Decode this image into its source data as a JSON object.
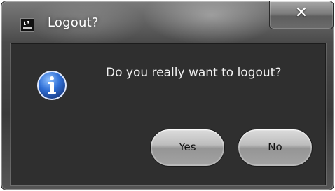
{
  "dialog": {
    "title": "Logout?",
    "message": "Do you really want to logout?",
    "close_label": "✕",
    "buttons": {
      "yes": "Yes",
      "no": "No"
    },
    "icons": {
      "app": "app-logo-icon",
      "info": "info-icon",
      "close": "close-icon"
    },
    "colors": {
      "frame": "#4a4a4a",
      "client_background": "#2f2f2f",
      "message_text": "#f2f2f2",
      "info_icon": "#2f6fd6"
    }
  }
}
